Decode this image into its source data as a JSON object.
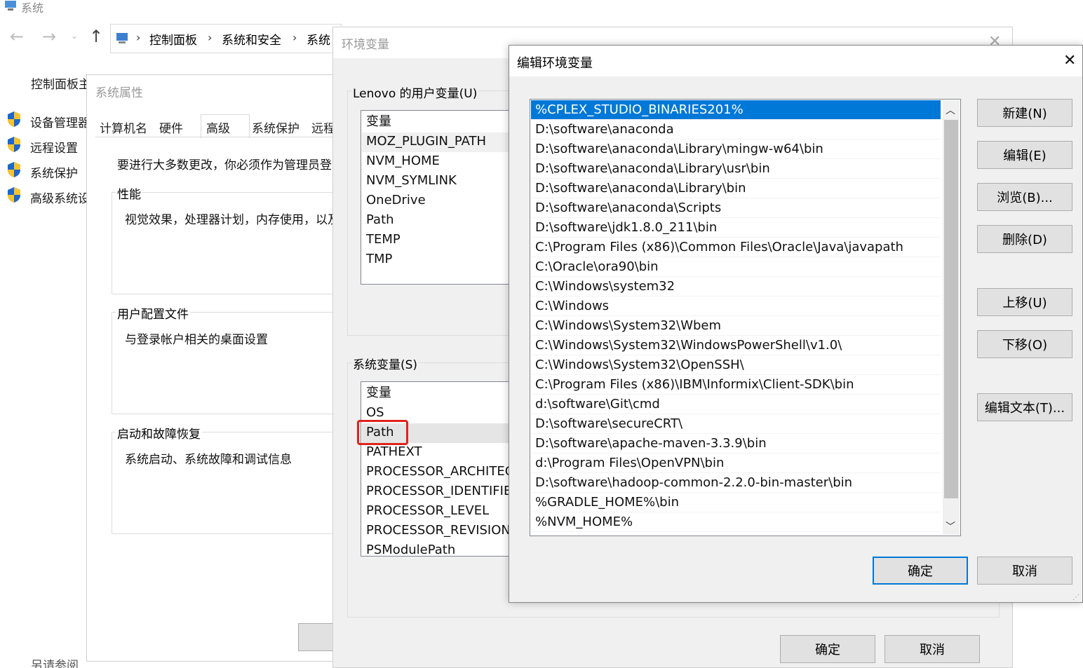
{
  "control_panel": {
    "window_title": "系统",
    "breadcrumb": [
      "控制面板",
      "系统和安全",
      "系统"
    ],
    "sidebar": [
      "控制面板主页",
      "设备管理器",
      "远程设置",
      "系统保护",
      "高级系统设置"
    ],
    "see_also": "另请参阅"
  },
  "system_properties": {
    "title": "系统属性",
    "tabs": [
      "计算机名",
      "硬件",
      "高级",
      "系统保护",
      "远程"
    ],
    "admin_note": "要进行大多数更改，你必须作为管理员登录。",
    "performance": {
      "title": "性能",
      "desc": "视觉效果，处理器计划，内存使用，以及虚拟内存"
    },
    "user_profiles": {
      "title": "用户配置文件",
      "desc": "与登录帐户相关的桌面设置"
    },
    "startup_recovery": {
      "title": "启动和故障恢复",
      "desc": "系统启动、系统故障和调试信息"
    }
  },
  "env_vars": {
    "title": "环境变量",
    "user_section": "Lenovo 的用户变量(U)",
    "user_header": "变量",
    "user_vars": [
      "MOZ_PLUGIN_PATH",
      "NVM_HOME",
      "NVM_SYMLINK",
      "OneDrive",
      "Path",
      "TEMP",
      "TMP"
    ],
    "system_section": "系统变量(S)",
    "system_header": "变量",
    "system_vars": [
      "OS",
      "Path",
      "PATHEXT",
      "PROCESSOR_ARCHITEC",
      "PROCESSOR_IDENTIFIE",
      "PROCESSOR_LEVEL",
      "PROCESSOR_REVISION",
      "PSModulePath"
    ],
    "highlighted_var": "Path",
    "ok": "确定",
    "cancel": "取消"
  },
  "edit_dialog": {
    "title": "编辑环境变量",
    "paths": [
      "%CPLEX_STUDIO_BINARIES201%",
      "D:\\software\\anaconda",
      "D:\\software\\anaconda\\Library\\mingw-w64\\bin",
      "D:\\software\\anaconda\\Library\\usr\\bin",
      "D:\\software\\anaconda\\Library\\bin",
      "D:\\software\\anaconda\\Scripts",
      "D:\\software\\jdk1.8.0_211\\bin",
      "C:\\Program Files (x86)\\Common Files\\Oracle\\Java\\javapath",
      "C:\\Oracle\\ora90\\bin",
      "C:\\Windows\\system32",
      "C:\\Windows",
      "C:\\Windows\\System32\\Wbem",
      "C:\\Windows\\System32\\WindowsPowerShell\\v1.0\\",
      "C:\\Windows\\System32\\OpenSSH\\",
      "C:\\Program Files (x86)\\IBM\\Informix\\Client-SDK\\bin",
      "d:\\software\\Git\\cmd",
      "D:\\software\\secureCRT\\",
      "D:\\software\\apache-maven-3.3.9\\bin",
      "d:\\Program Files\\OpenVPN\\bin",
      "D:\\software\\hadoop-common-2.2.0-bin-master\\bin",
      "%GRADLE_HOME%\\bin",
      "%NVM_HOME%"
    ],
    "buttons": {
      "new": "新建(N)",
      "edit": "编辑(E)",
      "browse": "浏览(B)...",
      "delete": "删除(D)",
      "move_up": "上移(U)",
      "move_down": "下移(O)",
      "edit_text": "编辑文本(T)...",
      "ok": "确定",
      "cancel": "取消"
    }
  }
}
